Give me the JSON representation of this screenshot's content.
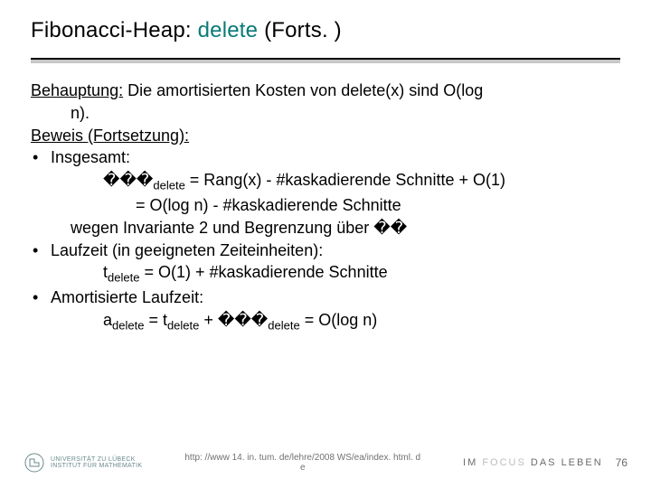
{
  "title": {
    "prefix": "Fibonacci-Heap: ",
    "teal": "delete",
    "suffix": " (Forts. )"
  },
  "body": {
    "claim_label": "Behauptung:",
    "claim_rest": " Die amortisierten Kosten von delete(x) sind O(log",
    "claim_line2": "n).",
    "proof_label": "Beweis (Fortsetzung):",
    "b1": "Insgesamt:",
    "b1_eq1_prefix": "���",
    "b1_eq1_sub": "delete",
    "b1_eq1_rest": " = Rang(x) - #kaskadierende Schnitte + O(1)",
    "b1_eq2": "= O(log n) - #kaskadierende Schnitte",
    "b1_reason_a": "wegen Invariante 2 und Begrenzung über ",
    "b1_reason_ph": "��",
    "b2": "Laufzeit (in geeigneten Zeiteinheiten):",
    "b2_eq_lhs": "t",
    "b2_eq_sub": "delete",
    "b2_eq_rhs": " = O(1) + #kaskadierende Schnitte",
    "b3": "Amortisierte Laufzeit:",
    "b3_a": "a",
    "b3_a_sub": "delete",
    "b3_mid1": " = t",
    "b3_t_sub": "delete",
    "b3_mid2": " + ",
    "b3_ph": "���",
    "b3_ph_sub": "delete",
    "b3_tail": " = O(log n)"
  },
  "footer": {
    "uni_line1": "UNIVERSITÄT ZU LÜBECK",
    "uni_line2": "INSTITUT FÜR MATHEMATIK",
    "url": "http: //www 14. in. tum. de/lehre/2008 WS/ea/index. html. d",
    "url2": "e",
    "focus_label": "IM FOCUS DAS LEBEN",
    "page": "76"
  }
}
